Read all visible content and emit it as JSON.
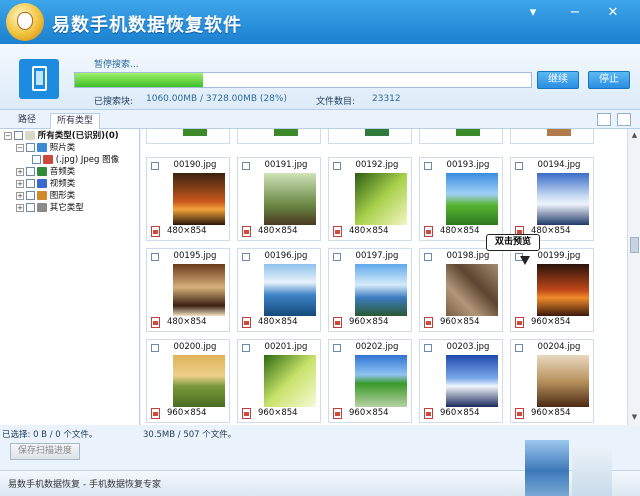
{
  "app": {
    "title": "易数手机数据恢复软件"
  },
  "window": {
    "minimize": "−",
    "close": "✕",
    "menu": "▾"
  },
  "scan": {
    "status": "暂停搜索...",
    "progress_fraction": 0.28,
    "continue_label": "继续",
    "stop_label": "停止",
    "searched_label": "已搜索块:",
    "searched_value": "1060.00MB / 3728.00MB (28%)",
    "files_label": "文件数目:",
    "files_value": "23312"
  },
  "tabs": [
    "路径",
    "所有类型"
  ],
  "tree": [
    {
      "exp": "⊟",
      "label": "所有类型(已识别)(0)",
      "bold": true
    },
    {
      "exp": "⊟",
      "label": "照片类"
    },
    {
      "exp": "",
      "label": "(.jpg) Jpeg 图像"
    },
    {
      "exp": "⊞",
      "label": "音频类"
    },
    {
      "exp": "⊞",
      "label": "视频类"
    },
    {
      "exp": "⊞",
      "label": "图形类"
    },
    {
      "exp": "⊞",
      "label": "其它类型"
    }
  ],
  "grid": {
    "rows": [
      [
        {
          "name": "00190.jpg",
          "dims": "480×854"
        },
        {
          "name": "00191.jpg",
          "dims": "480×854"
        },
        {
          "name": "00192.jpg",
          "dims": "480×854"
        },
        {
          "name": "00193.jpg",
          "dims": "480×854"
        },
        {
          "name": "00194.jpg",
          "dims": "480×854"
        }
      ],
      [
        {
          "name": "00195.jpg",
          "dims": "480×854"
        },
        {
          "name": "00196.jpg",
          "dims": "480×854"
        },
        {
          "name": "00197.jpg",
          "dims": "960×854"
        },
        {
          "name": "00198.jpg",
          "dims": "960×854"
        },
        {
          "name": "00199.jpg",
          "dims": "960×854"
        }
      ],
      [
        {
          "name": "00200.jpg",
          "dims": "960×854"
        },
        {
          "name": "00201.jpg",
          "dims": "960×854"
        },
        {
          "name": "00202.jpg",
          "dims": "960×854"
        },
        {
          "name": "00203.jpg",
          "dims": "960×854"
        },
        {
          "name": "00204.jpg",
          "dims": "960×854"
        }
      ]
    ]
  },
  "tooltip": "双击预览",
  "statusbar": {
    "selected": "已选择: 0 B / 0 个文件。",
    "total": "30.5MB / 507 个文件。"
  },
  "save_button": "保存扫描进度",
  "footer": "易数手机数据恢复 - 手机数据恢复专家",
  "colors": {
    "accent": "#1b80cf",
    "progress": "#3fbf2a"
  }
}
